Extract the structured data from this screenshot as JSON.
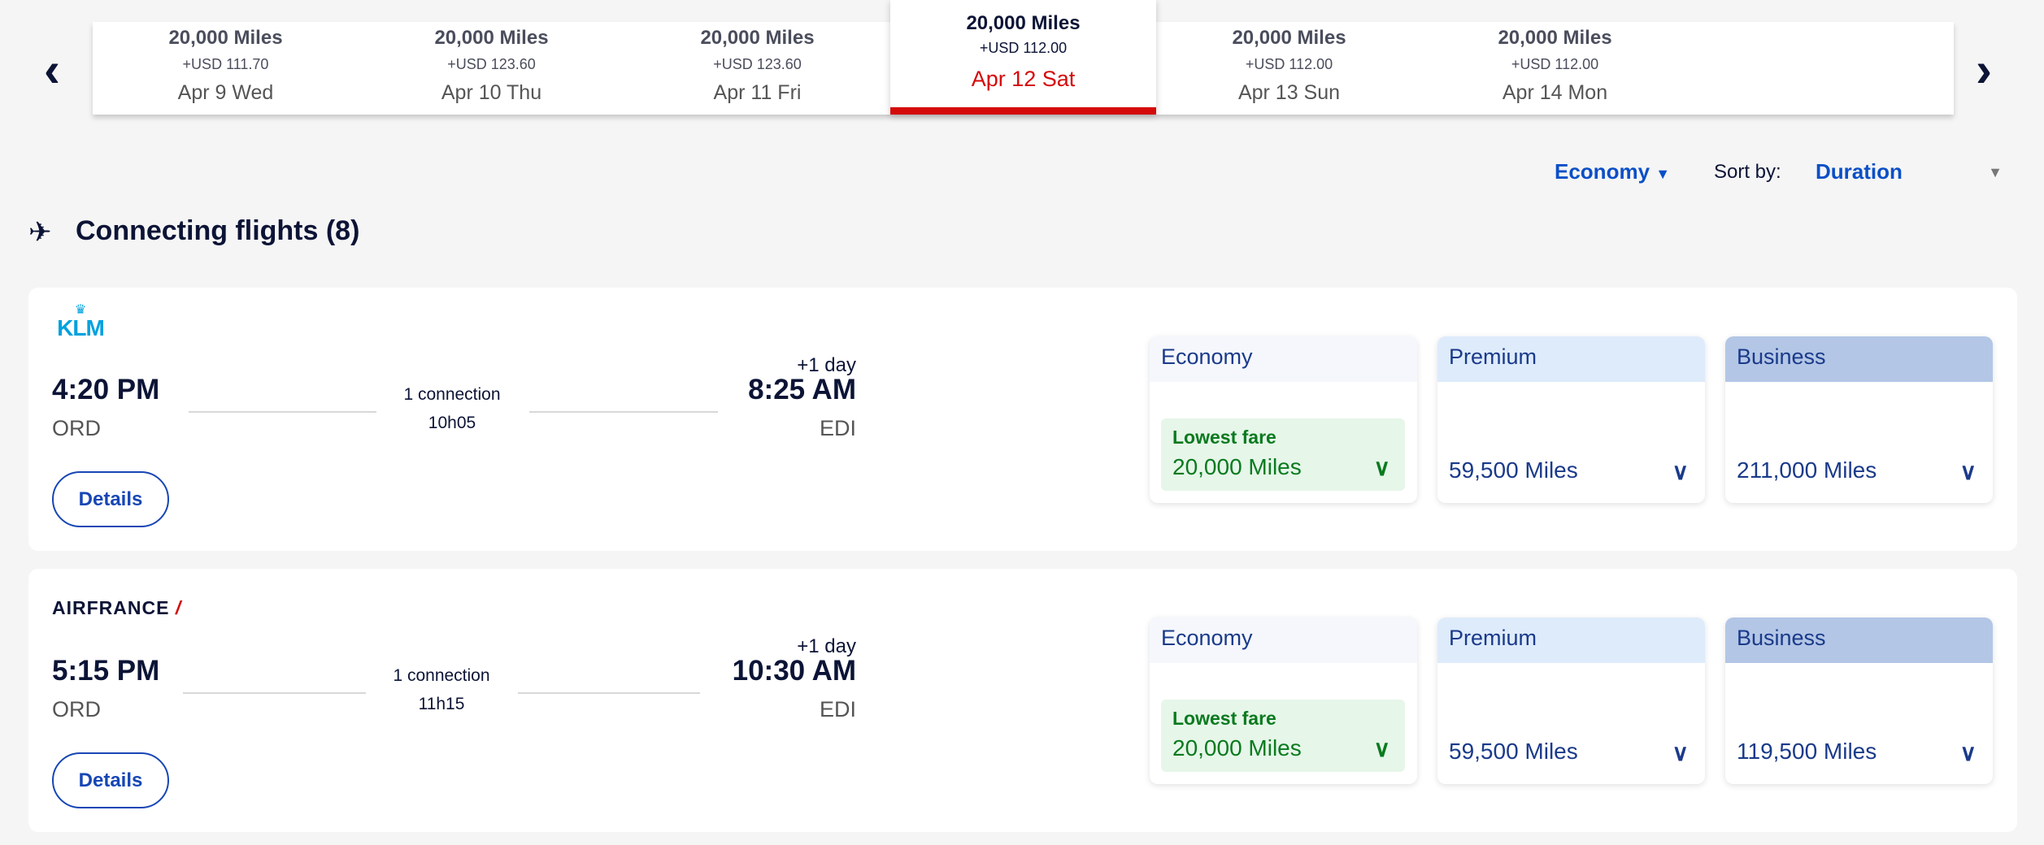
{
  "date_strip": [
    {
      "miles": "20,000 Miles",
      "usd": "+USD 111.70",
      "date": "Apr 9 Wed"
    },
    {
      "miles": "20,000 Miles",
      "usd": "+USD 123.60",
      "date": "Apr 10 Thu"
    },
    {
      "miles": "20,000 Miles",
      "usd": "+USD 123.60",
      "date": "Apr 11 Fri"
    },
    {
      "miles": "20,000 Miles",
      "usd": "+USD 112.00",
      "date": "Apr 12 Sat",
      "selected": true
    },
    {
      "miles": "20,000 Miles",
      "usd": "+USD 112.00",
      "date": "Apr 13 Sun"
    },
    {
      "miles": "20,000 Miles",
      "usd": "+USD 112.00",
      "date": "Apr 14 Mon"
    }
  ],
  "filters": {
    "cabin": "Economy",
    "sort_label": "Sort by:",
    "sort_value": "Duration"
  },
  "heading": "Connecting flights (8)",
  "flights": [
    {
      "airline": "KLM",
      "dep_time": "4:20 PM",
      "dep_code": "ORD",
      "connection": "1 connection",
      "duration": "10h05",
      "day_offset": "+1 day",
      "arr_time": "8:25 AM",
      "arr_code": "EDI",
      "details": "Details",
      "fares": [
        {
          "cabin": "Economy",
          "badge": "Lowest fare",
          "miles": "20,000 Miles"
        },
        {
          "cabin": "Premium",
          "miles": "59,500 Miles"
        },
        {
          "cabin": "Business",
          "miles": "211,000 Miles"
        }
      ]
    },
    {
      "airline": "AIRFRANCE",
      "dep_time": "5:15 PM",
      "dep_code": "ORD",
      "connection": "1 connection",
      "duration": "11h15",
      "day_offset": "+1 day",
      "arr_time": "10:30 AM",
      "arr_code": "EDI",
      "details": "Details",
      "fares": [
        {
          "cabin": "Economy",
          "badge": "Lowest fare",
          "miles": "20,000 Miles"
        },
        {
          "cabin": "Premium",
          "miles": "59,500 Miles"
        },
        {
          "cabin": "Business",
          "miles": "119,500 Miles"
        }
      ]
    }
  ],
  "colors": {
    "accent_red": "#d40a0a",
    "link_blue": "#0b4fc7",
    "navy": "#0c1436",
    "green": "#0a7a1e",
    "klm_blue": "#00a1de"
  }
}
